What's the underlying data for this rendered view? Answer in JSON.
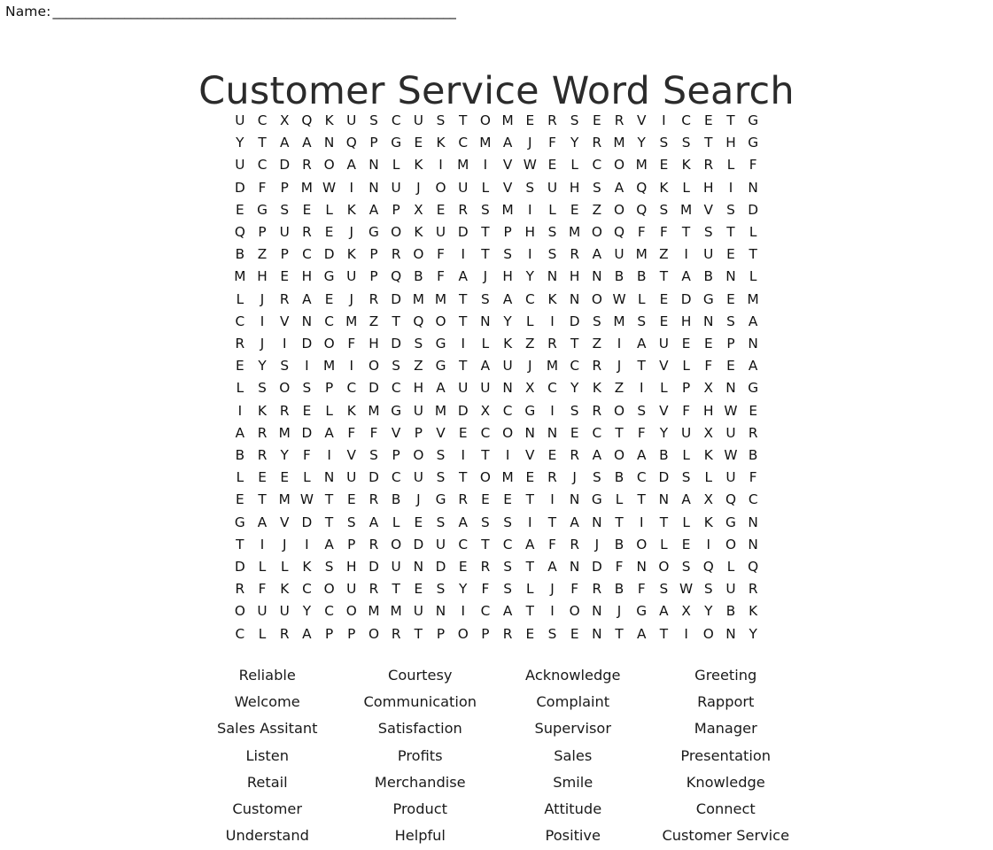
{
  "header": {
    "name_label": "Name:",
    "name_rule": "______________________________________________________________"
  },
  "title": "Customer Service Word Search",
  "grid": {
    "rows": 24,
    "cols": 24,
    "letters": [
      [
        "U",
        "C",
        "X",
        "Q",
        "K",
        "U",
        "S",
        "C",
        "U",
        "S",
        "T",
        "O",
        "M",
        "E",
        "R",
        "S",
        "E",
        "R",
        "V",
        "I",
        "C",
        "E",
        "T",
        "G"
      ],
      [
        "Y",
        "T",
        "A",
        "A",
        "N",
        "Q",
        "P",
        "G",
        "E",
        "K",
        "C",
        "M",
        "A",
        "J",
        "F",
        "Y",
        "R",
        "M",
        "Y",
        "S",
        "S",
        "T",
        "H",
        "G"
      ],
      [
        "U",
        "C",
        "D",
        "R",
        "O",
        "A",
        "N",
        "L",
        "K",
        "I",
        "M",
        "I",
        "V",
        "W",
        "E",
        "L",
        "C",
        "O",
        "M",
        "E",
        "K",
        "R",
        "L",
        "F"
      ],
      [
        "D",
        "F",
        "P",
        "M",
        "W",
        "I",
        "N",
        "U",
        "J",
        "O",
        "U",
        "L",
        "V",
        "S",
        "U",
        "H",
        "S",
        "A",
        "Q",
        "K",
        "L",
        "H",
        "I",
        "N"
      ],
      [
        "E",
        "G",
        "S",
        "E",
        "L",
        "K",
        "A",
        "P",
        "X",
        "E",
        "R",
        "S",
        "M",
        "I",
        "L",
        "E",
        "Z",
        "O",
        "Q",
        "S",
        "M",
        "V",
        "S",
        "D"
      ],
      [
        "Q",
        "P",
        "U",
        "R",
        "E",
        "J",
        "G",
        "O",
        "K",
        "U",
        "D",
        "T",
        "P",
        "H",
        "S",
        "M",
        "O",
        "Q",
        "F",
        "F",
        "T",
        "S",
        "T",
        "L"
      ],
      [
        "B",
        "Z",
        "P",
        "C",
        "D",
        "K",
        "P",
        "R",
        "O",
        "F",
        "I",
        "T",
        "S",
        "I",
        "S",
        "R",
        "A",
        "U",
        "M",
        "Z",
        "I",
        "U",
        "E",
        "T"
      ],
      [
        "M",
        "H",
        "E",
        "H",
        "G",
        "U",
        "P",
        "Q",
        "B",
        "F",
        "A",
        "J",
        "H",
        "Y",
        "N",
        "H",
        "N",
        "B",
        "B",
        "T",
        "A",
        "B",
        "N",
        "L"
      ],
      [
        "L",
        "J",
        "R",
        "A",
        "E",
        "J",
        "R",
        "D",
        "M",
        "M",
        "T",
        "S",
        "A",
        "C",
        "K",
        "N",
        "O",
        "W",
        "L",
        "E",
        "D",
        "G",
        "E",
        "M"
      ],
      [
        "C",
        "I",
        "V",
        "N",
        "C",
        "M",
        "Z",
        "T",
        "Q",
        "O",
        "T",
        "N",
        "Y",
        "L",
        "I",
        "D",
        "S",
        "M",
        "S",
        "E",
        "H",
        "N",
        "S",
        "A"
      ],
      [
        "R",
        "J",
        "I",
        "D",
        "O",
        "F",
        "H",
        "D",
        "S",
        "G",
        "I",
        "L",
        "K",
        "Z",
        "R",
        "T",
        "Z",
        "I",
        "A",
        "U",
        "E",
        "E",
        "P",
        "N"
      ],
      [
        "E",
        "Y",
        "S",
        "I",
        "M",
        "I",
        "O",
        "S",
        "Z",
        "G",
        "T",
        "A",
        "U",
        "J",
        "M",
        "C",
        "R",
        "J",
        "T",
        "V",
        "L",
        "F",
        "E",
        "A"
      ],
      [
        "L",
        "S",
        "O",
        "S",
        "P",
        "C",
        "D",
        "C",
        "H",
        "A",
        "U",
        "U",
        "N",
        "X",
        "C",
        "Y",
        "K",
        "Z",
        "I",
        "L",
        "P",
        "X",
        "N",
        "G"
      ],
      [
        "I",
        "K",
        "R",
        "E",
        "L",
        "K",
        "M",
        "G",
        "U",
        "M",
        "D",
        "X",
        "C",
        "G",
        "I",
        "S",
        "R",
        "O",
        "S",
        "V",
        "F",
        "H",
        "W",
        "E"
      ],
      [
        "A",
        "R",
        "M",
        "D",
        "A",
        "F",
        "F",
        "V",
        "P",
        "V",
        "E",
        "C",
        "O",
        "N",
        "N",
        "E",
        "C",
        "T",
        "F",
        "Y",
        "U",
        "X",
        "U",
        "R"
      ],
      [
        "B",
        "R",
        "Y",
        "F",
        "I",
        "V",
        "S",
        "P",
        "O",
        "S",
        "I",
        "T",
        "I",
        "V",
        "E",
        "R",
        "A",
        "O",
        "A",
        "B",
        "L",
        "K",
        "W",
        "B"
      ],
      [
        "L",
        "E",
        "E",
        "L",
        "N",
        "U",
        "D",
        "C",
        "U",
        "S",
        "T",
        "O",
        "M",
        "E",
        "R",
        "J",
        "S",
        "B",
        "C",
        "D",
        "S",
        "L",
        "U",
        "F"
      ],
      [
        "E",
        "T",
        "M",
        "W",
        "T",
        "E",
        "R",
        "B",
        "J",
        "G",
        "R",
        "E",
        "E",
        "T",
        "I",
        "N",
        "G",
        "L",
        "T",
        "N",
        "A",
        "X",
        "Q",
        "C"
      ],
      [
        "G",
        "A",
        "V",
        "D",
        "T",
        "S",
        "A",
        "L",
        "E",
        "S",
        "A",
        "S",
        "S",
        "I",
        "T",
        "A",
        "N",
        "T",
        "I",
        "T",
        "L",
        "K",
        "G",
        "N"
      ],
      [
        "T",
        "I",
        "J",
        "I",
        "A",
        "P",
        "R",
        "O",
        "D",
        "U",
        "C",
        "T",
        "C",
        "A",
        "F",
        "R",
        "J",
        "B",
        "O",
        "L",
        "E",
        "I",
        "O",
        "N"
      ],
      [
        "D",
        "L",
        "L",
        "K",
        "S",
        "H",
        "D",
        "U",
        "N",
        "D",
        "E",
        "R",
        "S",
        "T",
        "A",
        "N",
        "D",
        "F",
        "N",
        "O",
        "S",
        "Q",
        "L",
        "Q"
      ],
      [
        "R",
        "F",
        "K",
        "C",
        "O",
        "U",
        "R",
        "T",
        "E",
        "S",
        "Y",
        "F",
        "S",
        "L",
        "J",
        "F",
        "R",
        "B",
        "F",
        "S",
        "W",
        "S",
        "U",
        "R"
      ],
      [
        "O",
        "U",
        "U",
        "Y",
        "C",
        "O",
        "M",
        "M",
        "U",
        "N",
        "I",
        "C",
        "A",
        "T",
        "I",
        "O",
        "N",
        "J",
        "G",
        "A",
        "X",
        "Y",
        "B",
        "K"
      ],
      [
        "C",
        "L",
        "R",
        "A",
        "P",
        "P",
        "O",
        "R",
        "T",
        "P",
        "O",
        "P",
        "R",
        "E",
        "S",
        "E",
        "N",
        "T",
        "A",
        "T",
        "I",
        "O",
        "N",
        "Y"
      ]
    ]
  },
  "wordlist": {
    "rows": [
      [
        "Reliable",
        "Courtesy",
        "Acknowledge",
        "Greeting"
      ],
      [
        "Welcome",
        "Communication",
        "Complaint",
        "Rapport"
      ],
      [
        "Sales Assitant",
        "Satisfaction",
        "Supervisor",
        "Manager"
      ],
      [
        "Listen",
        "Profits",
        "Sales",
        "Presentation"
      ],
      [
        "Retail",
        "Merchandise",
        "Smile",
        "Knowledge"
      ],
      [
        "Customer",
        "Product",
        "Attitude",
        "Connect"
      ],
      [
        "Understand",
        "Helpful",
        "Positive",
        "Customer Service"
      ]
    ]
  },
  "colors": {
    "text": "#111111",
    "title": "#2b2b2b",
    "background": "#ffffff"
  }
}
